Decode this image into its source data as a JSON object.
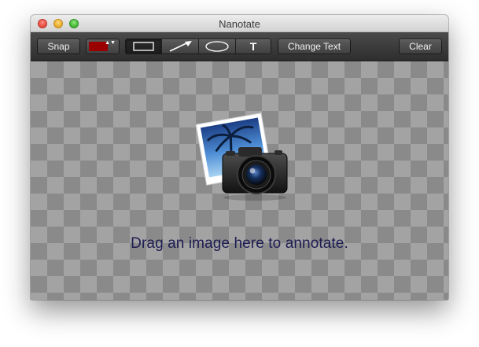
{
  "window": {
    "title": "Nanotate"
  },
  "toolbar": {
    "snap_label": "Snap",
    "color": {
      "current": "#9a0000",
      "arrows": "▲▼"
    },
    "tools": [
      {
        "name": "rectangle",
        "icon": "rectangle-icon",
        "selected": true
      },
      {
        "name": "arrow",
        "icon": "arrow-icon",
        "selected": false
      },
      {
        "name": "ellipse",
        "icon": "ellipse-icon",
        "selected": false
      },
      {
        "name": "text",
        "icon": "text-icon",
        "label": "T",
        "selected": false
      }
    ],
    "change_text_label": "Change Text",
    "clear_label": "Clear"
  },
  "canvas": {
    "placeholder_icon": "photo-camera-icon",
    "placeholder_text": "Drag an image here to annotate."
  }
}
